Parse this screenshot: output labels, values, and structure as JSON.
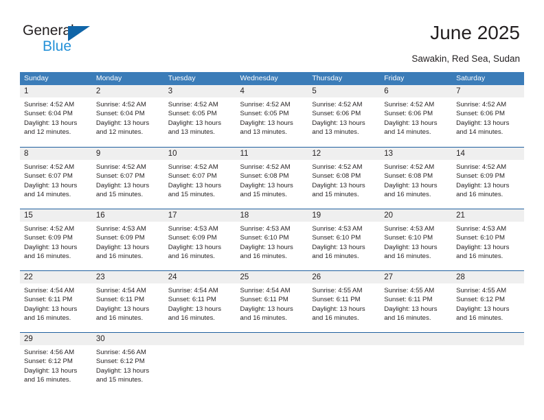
{
  "brand": {
    "name_line1": "General",
    "name_line2": "Blue",
    "color_dark": "#231f20",
    "color_blue": "#2491d8",
    "triangle_color": "#1065a8"
  },
  "header": {
    "title": "June 2025",
    "subtitle": "Sawakin, Red Sea, Sudan"
  },
  "colors": {
    "header_row_bg": "#3b7cb8",
    "header_row_text": "#ffffff",
    "week_divider": "#1d5e9e",
    "day_number_band": "#efefef",
    "text": "#231f20"
  },
  "calendar": {
    "weekday_headers": [
      "Sunday",
      "Monday",
      "Tuesday",
      "Wednesday",
      "Thursday",
      "Friday",
      "Saturday"
    ],
    "weeks": [
      [
        {
          "day": "1",
          "sunrise": "Sunrise: 4:52 AM",
          "sunset": "Sunset: 6:04 PM",
          "daylight_1": "Daylight: 13 hours",
          "daylight_2": "and 12 minutes."
        },
        {
          "day": "2",
          "sunrise": "Sunrise: 4:52 AM",
          "sunset": "Sunset: 6:04 PM",
          "daylight_1": "Daylight: 13 hours",
          "daylight_2": "and 12 minutes."
        },
        {
          "day": "3",
          "sunrise": "Sunrise: 4:52 AM",
          "sunset": "Sunset: 6:05 PM",
          "daylight_1": "Daylight: 13 hours",
          "daylight_2": "and 13 minutes."
        },
        {
          "day": "4",
          "sunrise": "Sunrise: 4:52 AM",
          "sunset": "Sunset: 6:05 PM",
          "daylight_1": "Daylight: 13 hours",
          "daylight_2": "and 13 minutes."
        },
        {
          "day": "5",
          "sunrise": "Sunrise: 4:52 AM",
          "sunset": "Sunset: 6:06 PM",
          "daylight_1": "Daylight: 13 hours",
          "daylight_2": "and 13 minutes."
        },
        {
          "day": "6",
          "sunrise": "Sunrise: 4:52 AM",
          "sunset": "Sunset: 6:06 PM",
          "daylight_1": "Daylight: 13 hours",
          "daylight_2": "and 14 minutes."
        },
        {
          "day": "7",
          "sunrise": "Sunrise: 4:52 AM",
          "sunset": "Sunset: 6:06 PM",
          "daylight_1": "Daylight: 13 hours",
          "daylight_2": "and 14 minutes."
        }
      ],
      [
        {
          "day": "8",
          "sunrise": "Sunrise: 4:52 AM",
          "sunset": "Sunset: 6:07 PM",
          "daylight_1": "Daylight: 13 hours",
          "daylight_2": "and 14 minutes."
        },
        {
          "day": "9",
          "sunrise": "Sunrise: 4:52 AM",
          "sunset": "Sunset: 6:07 PM",
          "daylight_1": "Daylight: 13 hours",
          "daylight_2": "and 15 minutes."
        },
        {
          "day": "10",
          "sunrise": "Sunrise: 4:52 AM",
          "sunset": "Sunset: 6:07 PM",
          "daylight_1": "Daylight: 13 hours",
          "daylight_2": "and 15 minutes."
        },
        {
          "day": "11",
          "sunrise": "Sunrise: 4:52 AM",
          "sunset": "Sunset: 6:08 PM",
          "daylight_1": "Daylight: 13 hours",
          "daylight_2": "and 15 minutes."
        },
        {
          "day": "12",
          "sunrise": "Sunrise: 4:52 AM",
          "sunset": "Sunset: 6:08 PM",
          "daylight_1": "Daylight: 13 hours",
          "daylight_2": "and 15 minutes."
        },
        {
          "day": "13",
          "sunrise": "Sunrise: 4:52 AM",
          "sunset": "Sunset: 6:08 PM",
          "daylight_1": "Daylight: 13 hours",
          "daylight_2": "and 16 minutes."
        },
        {
          "day": "14",
          "sunrise": "Sunrise: 4:52 AM",
          "sunset": "Sunset: 6:09 PM",
          "daylight_1": "Daylight: 13 hours",
          "daylight_2": "and 16 minutes."
        }
      ],
      [
        {
          "day": "15",
          "sunrise": "Sunrise: 4:52 AM",
          "sunset": "Sunset: 6:09 PM",
          "daylight_1": "Daylight: 13 hours",
          "daylight_2": "and 16 minutes."
        },
        {
          "day": "16",
          "sunrise": "Sunrise: 4:53 AM",
          "sunset": "Sunset: 6:09 PM",
          "daylight_1": "Daylight: 13 hours",
          "daylight_2": "and 16 minutes."
        },
        {
          "day": "17",
          "sunrise": "Sunrise: 4:53 AM",
          "sunset": "Sunset: 6:09 PM",
          "daylight_1": "Daylight: 13 hours",
          "daylight_2": "and 16 minutes."
        },
        {
          "day": "18",
          "sunrise": "Sunrise: 4:53 AM",
          "sunset": "Sunset: 6:10 PM",
          "daylight_1": "Daylight: 13 hours",
          "daylight_2": "and 16 minutes."
        },
        {
          "day": "19",
          "sunrise": "Sunrise: 4:53 AM",
          "sunset": "Sunset: 6:10 PM",
          "daylight_1": "Daylight: 13 hours",
          "daylight_2": "and 16 minutes."
        },
        {
          "day": "20",
          "sunrise": "Sunrise: 4:53 AM",
          "sunset": "Sunset: 6:10 PM",
          "daylight_1": "Daylight: 13 hours",
          "daylight_2": "and 16 minutes."
        },
        {
          "day": "21",
          "sunrise": "Sunrise: 4:53 AM",
          "sunset": "Sunset: 6:10 PM",
          "daylight_1": "Daylight: 13 hours",
          "daylight_2": "and 16 minutes."
        }
      ],
      [
        {
          "day": "22",
          "sunrise": "Sunrise: 4:54 AM",
          "sunset": "Sunset: 6:11 PM",
          "daylight_1": "Daylight: 13 hours",
          "daylight_2": "and 16 minutes."
        },
        {
          "day": "23",
          "sunrise": "Sunrise: 4:54 AM",
          "sunset": "Sunset: 6:11 PM",
          "daylight_1": "Daylight: 13 hours",
          "daylight_2": "and 16 minutes."
        },
        {
          "day": "24",
          "sunrise": "Sunrise: 4:54 AM",
          "sunset": "Sunset: 6:11 PM",
          "daylight_1": "Daylight: 13 hours",
          "daylight_2": "and 16 minutes."
        },
        {
          "day": "25",
          "sunrise": "Sunrise: 4:54 AM",
          "sunset": "Sunset: 6:11 PM",
          "daylight_1": "Daylight: 13 hours",
          "daylight_2": "and 16 minutes."
        },
        {
          "day": "26",
          "sunrise": "Sunrise: 4:55 AM",
          "sunset": "Sunset: 6:11 PM",
          "daylight_1": "Daylight: 13 hours",
          "daylight_2": "and 16 minutes."
        },
        {
          "day": "27",
          "sunrise": "Sunrise: 4:55 AM",
          "sunset": "Sunset: 6:11 PM",
          "daylight_1": "Daylight: 13 hours",
          "daylight_2": "and 16 minutes."
        },
        {
          "day": "28",
          "sunrise": "Sunrise: 4:55 AM",
          "sunset": "Sunset: 6:12 PM",
          "daylight_1": "Daylight: 13 hours",
          "daylight_2": "and 16 minutes."
        }
      ],
      [
        {
          "day": "29",
          "sunrise": "Sunrise: 4:56 AM",
          "sunset": "Sunset: 6:12 PM",
          "daylight_1": "Daylight: 13 hours",
          "daylight_2": "and 16 minutes."
        },
        {
          "day": "30",
          "sunrise": "Sunrise: 4:56 AM",
          "sunset": "Sunset: 6:12 PM",
          "daylight_1": "Daylight: 13 hours",
          "daylight_2": "and 15 minutes."
        },
        {
          "day": "",
          "sunrise": "",
          "sunset": "",
          "daylight_1": "",
          "daylight_2": ""
        },
        {
          "day": "",
          "sunrise": "",
          "sunset": "",
          "daylight_1": "",
          "daylight_2": ""
        },
        {
          "day": "",
          "sunrise": "",
          "sunset": "",
          "daylight_1": "",
          "daylight_2": ""
        },
        {
          "day": "",
          "sunrise": "",
          "sunset": "",
          "daylight_1": "",
          "daylight_2": ""
        },
        {
          "day": "",
          "sunrise": "",
          "sunset": "",
          "daylight_1": "",
          "daylight_2": ""
        }
      ]
    ]
  }
}
